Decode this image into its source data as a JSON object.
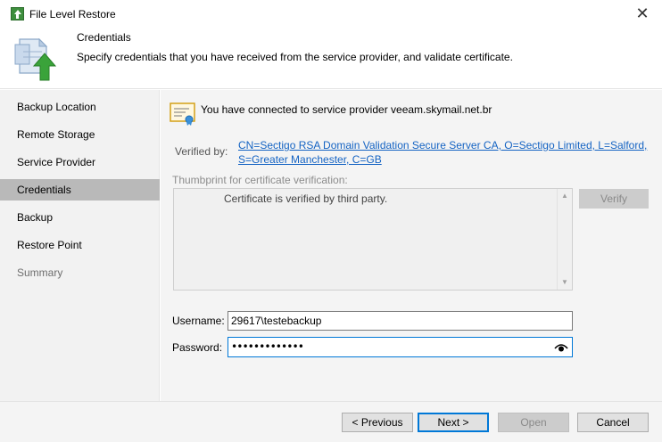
{
  "window": {
    "title": "File Level Restore",
    "close_glyph": "✕"
  },
  "header": {
    "title": "Credentials",
    "description": "Specify credentials that you have received from the service provider, and validate certificate."
  },
  "sidebar": {
    "items": [
      {
        "label": "Backup Location",
        "state": "normal"
      },
      {
        "label": "Remote Storage",
        "state": "normal"
      },
      {
        "label": "Service Provider",
        "state": "normal"
      },
      {
        "label": "Credentials",
        "state": "active"
      },
      {
        "label": "Backup",
        "state": "normal"
      },
      {
        "label": "Restore Point",
        "state": "normal"
      },
      {
        "label": "Summary",
        "state": "disabled"
      }
    ]
  },
  "main": {
    "connected_text": "You have connected to service provider veeam.skymail.net.br",
    "verified_label": "Verified by:",
    "verified_line1": "CN=Sectigo RSA Domain Validation Secure Server CA, O=Sectigo Limited, L=Salford,",
    "verified_line2": "S=Greater Manchester, C=GB",
    "thumbprint_label": "Thumbprint for certificate verification:",
    "thumbprint_text": "Certificate is verified by third party.",
    "verify_button": "Verify",
    "username_label": "Username:",
    "username_value": "29617\\testebackup",
    "password_label": "Password:",
    "password_value": "•••••••••••••"
  },
  "footer": {
    "previous": "< Previous",
    "next": "Next >",
    "open": "Open",
    "cancel": "Cancel"
  },
  "colors": {
    "link": "#1463c3",
    "active_nav": "#b9b9b9",
    "focus_border": "#0078d7",
    "brand_green": "#3e8f3e"
  },
  "icons": {
    "app": "restore-app-icon",
    "header": "restore-wizard-icon",
    "certificate": "certificate-icon",
    "eye": "show-password-icon"
  }
}
